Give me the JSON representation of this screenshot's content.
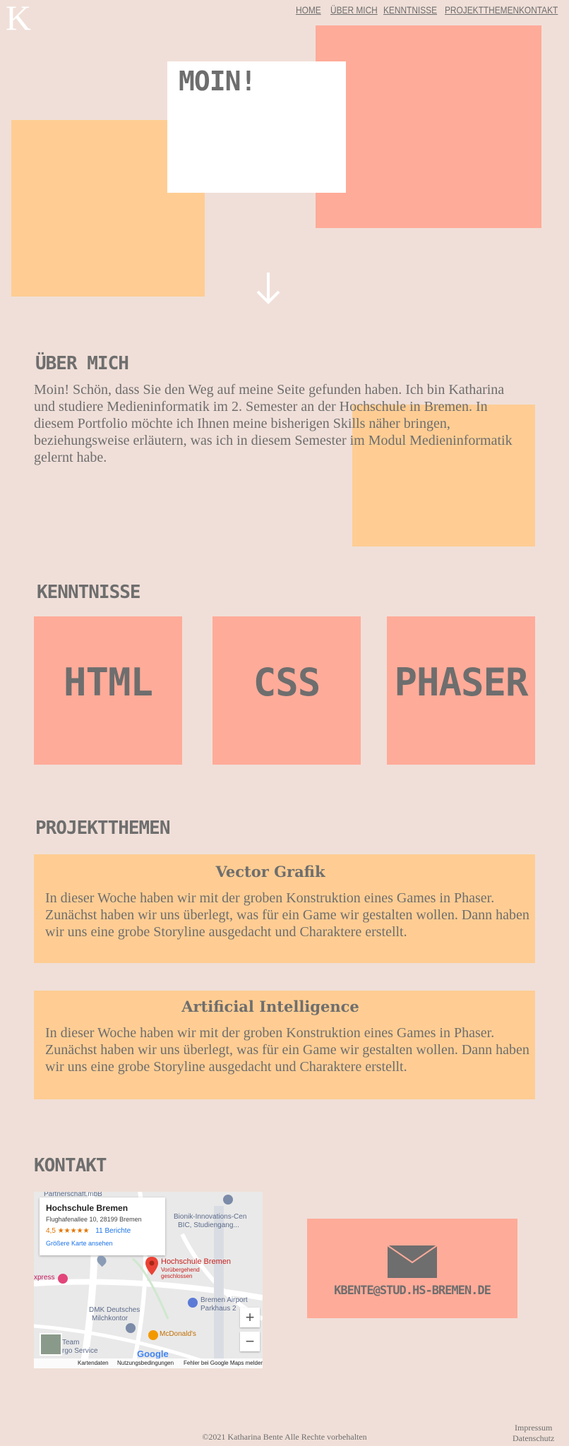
{
  "header": {
    "logo": "K",
    "nav": [
      "HOME",
      "ÜBER MICH",
      "KENNTNISSE",
      "PROJEKTTHEMEN",
      "KONTAKT"
    ]
  },
  "hero": {
    "title": "MOIN!",
    "arrow_icon": "arrow-down-icon"
  },
  "about": {
    "title": "ÜBER MICH",
    "text": "Moin! Schön, dass Sie den Weg auf meine Seite gefunden haben. Ich bin Katharina und studiere Medieninformatik im 2. Semester an der Hochschule in Bremen. In diesem Portfolio möchte ich Ihnen meine bisherigen Skills näher bringen, beziehungsweise erläutern, was ich in diesem Semester im Modul Medieninformatik gelernt habe."
  },
  "skills": {
    "title": "KENNTNISSE",
    "items": [
      "HTML",
      "CSS",
      "PHASER"
    ]
  },
  "projects": {
    "title": "PROJEKTTHEMEN",
    "items": [
      {
        "title": "Vector Grafik",
        "text": "In dieser Woche haben wir mit der groben Konstruktion eines Games in Phaser. Zunächst haben wir uns überlegt, was für ein Game wir gestalten wollen. Dann haben wir uns eine grobe Storyline ausgedacht und Charaktere erstellt."
      },
      {
        "title": "Artificial Intelligence",
        "text": "In dieser Woche haben wir mit der groben Konstruktion eines Games in Phaser. Zunächst haben wir uns überlegt, was für ein Game wir gestalten wollen. Dann haben wir uns eine grobe Storyline ausgedacht und Charaktere erstellt."
      }
    ]
  },
  "contact": {
    "title": "KONTAKT",
    "email": "KBENTE@STUD.HS-BREMEN.DE",
    "map": {
      "place_name": "Hochschule Bremen",
      "address": "Flughafenallee 10, 28199 Bremen",
      "rating": "4,5",
      "stars": "★★★★★",
      "reviews": "11 Berichte",
      "larger_map": "Größere Karte ansehen",
      "pin_label": "Hochschule Bremen",
      "pin_status_1": "Vorübergehend",
      "pin_status_2": "geschlossen",
      "labels": [
        "Partnerschaft.mbB",
        "Bionik-Innovations-Cen",
        "BIC, Studiengang...",
        "xpress",
        "Bremen Airport",
        "Parkhaus 2",
        "DMK Deutsches",
        "Milchkontor",
        "McDonald's",
        "Team",
        "rgo Service"
      ],
      "google": "Google",
      "footer_links": [
        "Kartendaten",
        "Nutzungsbedingungen",
        "Fehler bei Google Maps melden"
      ],
      "zoom_in": "+",
      "zoom_out": "−"
    }
  },
  "footer": {
    "copyright": "©2021 Katharina Bente Alle Rechte vorbehalten",
    "impressum": "Impressum",
    "datenschutz": "Datenschutz"
  },
  "colors": {
    "background": "#f0dfd8",
    "salmon": "#ffab99",
    "peach": "#ffcd93",
    "text": "#6e6e6e"
  }
}
